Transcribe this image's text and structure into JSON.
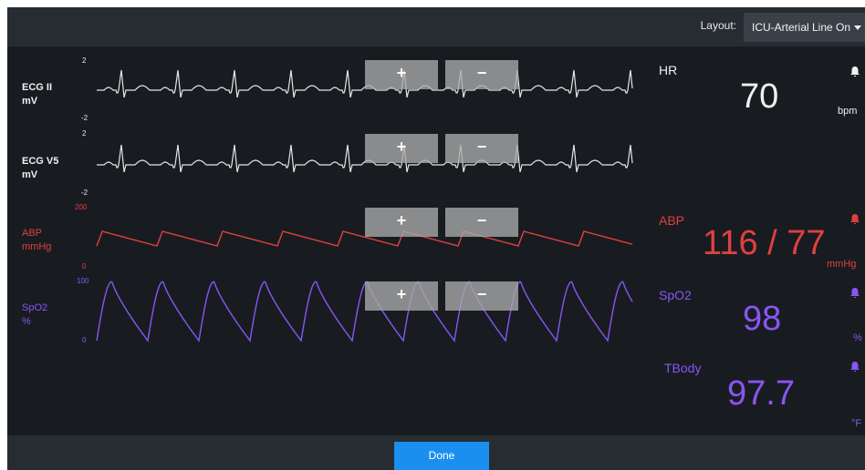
{
  "header": {
    "layout_label": "Layout:",
    "layout_value": "ICU-Arterial Line On"
  },
  "colors": {
    "ecg": "#e6e6e6",
    "abp": "#e0403f",
    "spo2": "#8a55f2",
    "tbody": "#8a55f2",
    "done": "#1a8ff0"
  },
  "waveforms": [
    {
      "name": "ECG II",
      "unit": "mV",
      "scale_max": "2",
      "scale_min": "-2",
      "plus": "+",
      "minus": "−"
    },
    {
      "name": "ECG V5",
      "unit": "mV",
      "scale_max": "2",
      "scale_min": "-2",
      "plus": "+",
      "minus": "−"
    },
    {
      "name": "ABP",
      "unit": "mmHg",
      "scale_max": "200",
      "scale_min": "0",
      "plus": "+",
      "minus": "−"
    },
    {
      "name": "SpO2",
      "unit": "%",
      "scale_max": "100",
      "scale_min": "0",
      "plus": "+",
      "minus": "−"
    }
  ],
  "vitals": [
    {
      "name": "HR",
      "value": "70",
      "unit": "bpm",
      "icon": "bell-icon"
    },
    {
      "name": "ABP",
      "value": "116 / 77",
      "unit": "mmHg",
      "icon": "bell-icon"
    },
    {
      "name": "SpO2",
      "value": "98",
      "unit": "%",
      "icon": "bell-icon"
    },
    {
      "name": "TBody",
      "value": "97.7",
      "unit": "°F",
      "icon": "bell-icon"
    }
  ],
  "footer": {
    "done_label": "Done"
  }
}
